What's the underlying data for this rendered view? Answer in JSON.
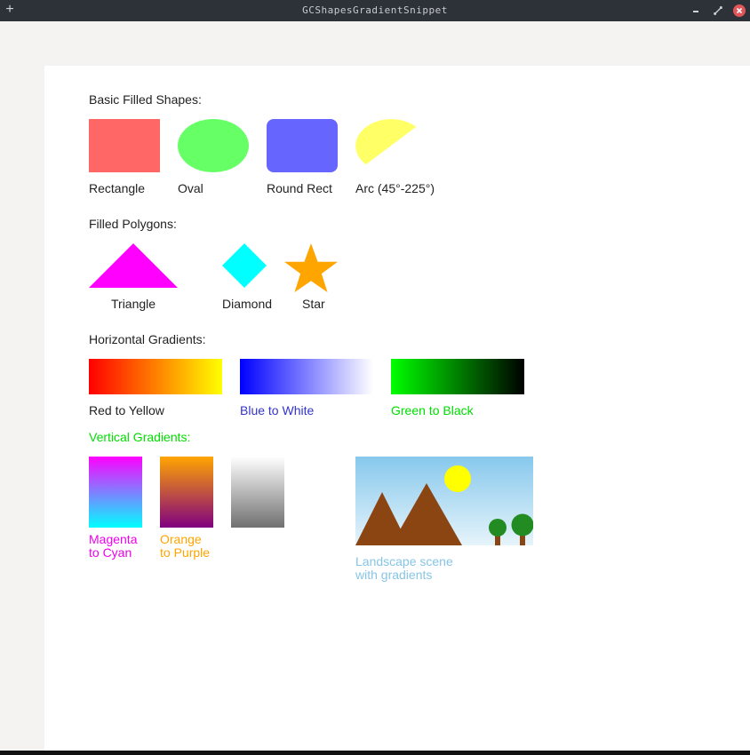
{
  "window": {
    "title": "GCShapesGradientSnippet",
    "icons": {
      "pin": "pin-icon",
      "minimize": "minimize-icon",
      "maximize": "maximize-icon",
      "close": "close-icon"
    }
  },
  "sections": {
    "basic": "Basic Filled Shapes:",
    "polygons": "Filled Polygons:",
    "horizontal": "Horizontal Gradients:",
    "vertical": "Vertical Gradients:"
  },
  "basic_shapes": {
    "rectangle": "Rectangle",
    "oval": "Oval",
    "round_rect": "Round Rect",
    "arc": "Arc (45°-225°)"
  },
  "polygons": {
    "triangle": "Triangle",
    "diamond": "Diamond",
    "star": "Star"
  },
  "horizontal_gradients": {
    "red_yellow": "Red to Yellow",
    "blue_white": "Blue to White",
    "green_black": "Green to Black"
  },
  "vertical_gradients": {
    "magenta_cyan": "Magenta\nto Cyan",
    "orange_purple": "Orange\nto Purple"
  },
  "landscape": {
    "caption": "Landscape scene\nwith gradients"
  },
  "colors": {
    "rectangle": "#ff6666",
    "oval": "#66ff66",
    "round_rect": "#6666ff",
    "arc": "#ffff66",
    "triangle": "#ff00ff",
    "diamond": "#00ffff",
    "star": "#ffa500",
    "blue_label": "#3333cc",
    "green_label": "#00dd00",
    "magenta_label": "#ee00ee",
    "orange_label": "#ffa500",
    "landscape_label": "#87c5e6",
    "mountain": "#8b4513",
    "sun": "#ffff00",
    "tree": "#228b22"
  }
}
